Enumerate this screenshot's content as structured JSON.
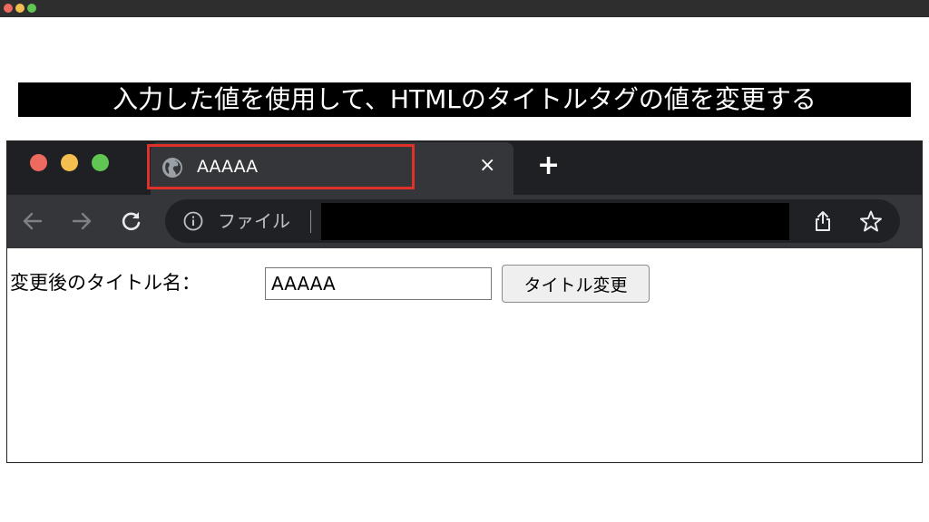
{
  "colors": {
    "close": "#ec6a5e",
    "minimize": "#f4bf4f",
    "maximize": "#61c554",
    "highlight": "#e0302a",
    "caption_bg": "#000000"
  },
  "caption": "入力した値を使用して、HTMLのタイトルタグの値を変更する",
  "browser": {
    "tab": {
      "title": "AAAAA",
      "favicon": "globe-icon",
      "close_symbol": "×"
    },
    "new_tab_symbol": "+",
    "toolbar": {
      "back_icon": "arrow-left-icon",
      "forward_icon": "arrow-right-icon",
      "reload_icon": "reload-icon",
      "info_icon": "info-icon",
      "address_label": "ファイル",
      "share_icon": "share-icon",
      "bookmark_icon": "star-icon"
    }
  },
  "page": {
    "label": "変更後のタイトル名：",
    "input_value": "AAAAA",
    "button_label": "タイトル変更"
  }
}
